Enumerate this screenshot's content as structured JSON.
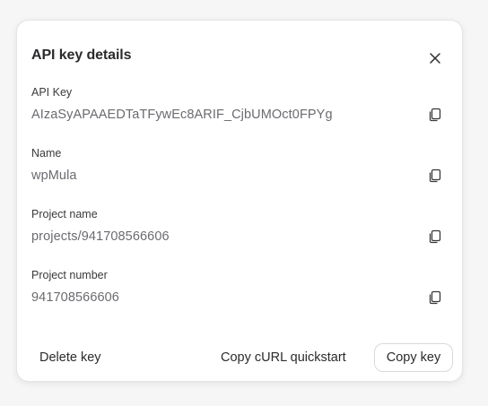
{
  "dialog": {
    "title": "API key details",
    "close_icon": "close-icon"
  },
  "fields": [
    {
      "label": "API Key",
      "value": "AIzaSyAPAAEDTaTFywEc8ARIF_CjbUMOct0FPYg"
    },
    {
      "label": "Name",
      "value": "wpMula"
    },
    {
      "label": "Project name",
      "value": "projects/941708566606"
    },
    {
      "label": "Project number",
      "value": "941708566606"
    }
  ],
  "icons": {
    "copy": "copy-icon",
    "close": "close-icon"
  },
  "footer": {
    "delete_label": "Delete key",
    "curl_label": "Copy cURL quickstart",
    "copy_key_label": "Copy key"
  },
  "colors": {
    "text_primary": "#2b2b2e",
    "text_secondary": "#6b6b70",
    "border": "#e6e6e8"
  }
}
